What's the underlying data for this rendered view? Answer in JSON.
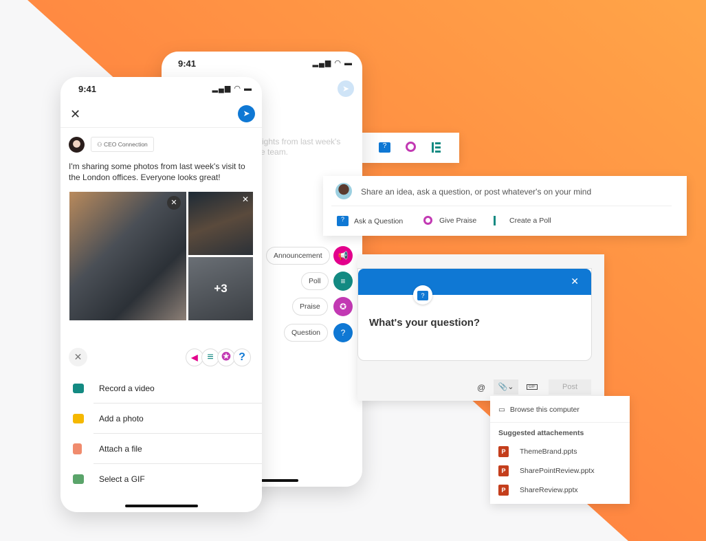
{
  "colors": {
    "orange": "#ff8a45",
    "blue": "#0f78d4",
    "teal": "#138a82",
    "magenta": "#c239b3",
    "pink": "#e3008c"
  },
  "back_phone": {
    "time": "9:41",
    "faded_text_line1": "sights from last week's",
    "faded_text_line2": "e team.",
    "fab_options": [
      {
        "label": "Announcement",
        "icon": "megaphone-icon"
      },
      {
        "label": "Poll",
        "icon": "poll-icon"
      },
      {
        "label": "Praise",
        "icon": "praise-badge-icon"
      },
      {
        "label": "Question",
        "icon": "question-icon"
      }
    ]
  },
  "front_phone": {
    "time": "9:41",
    "community": "CEO Connection",
    "post_text": "I'm sharing some photos from last week's visit to the London offices. Everyone looks great!",
    "more_photos": "+3",
    "actions": [
      {
        "label": "Record a video",
        "icon": "video-icon"
      },
      {
        "label": "Add a photo",
        "icon": "camera-icon"
      },
      {
        "label": "Attach a file",
        "icon": "file-icon"
      },
      {
        "label": "Select a GIF",
        "icon": "gif-icon"
      }
    ]
  },
  "composer": {
    "placeholder": "Share an idea, ask a question, or post whatever's on your mind",
    "actions": [
      {
        "label": "Ask a Question"
      },
      {
        "label": "Give Praise"
      },
      {
        "label": "Create a Poll"
      }
    ]
  },
  "question_card": {
    "title": "What's your question?",
    "post_label": "Post",
    "gif_label": "GIF",
    "at_label": "@"
  },
  "attach_menu": {
    "browse": "Browse this computer",
    "suggested_header": "Suggested attachements",
    "files": [
      "ThemeBrand.ppts",
      "SharePointReview.pptx",
      "ShareReview.pptx"
    ]
  }
}
